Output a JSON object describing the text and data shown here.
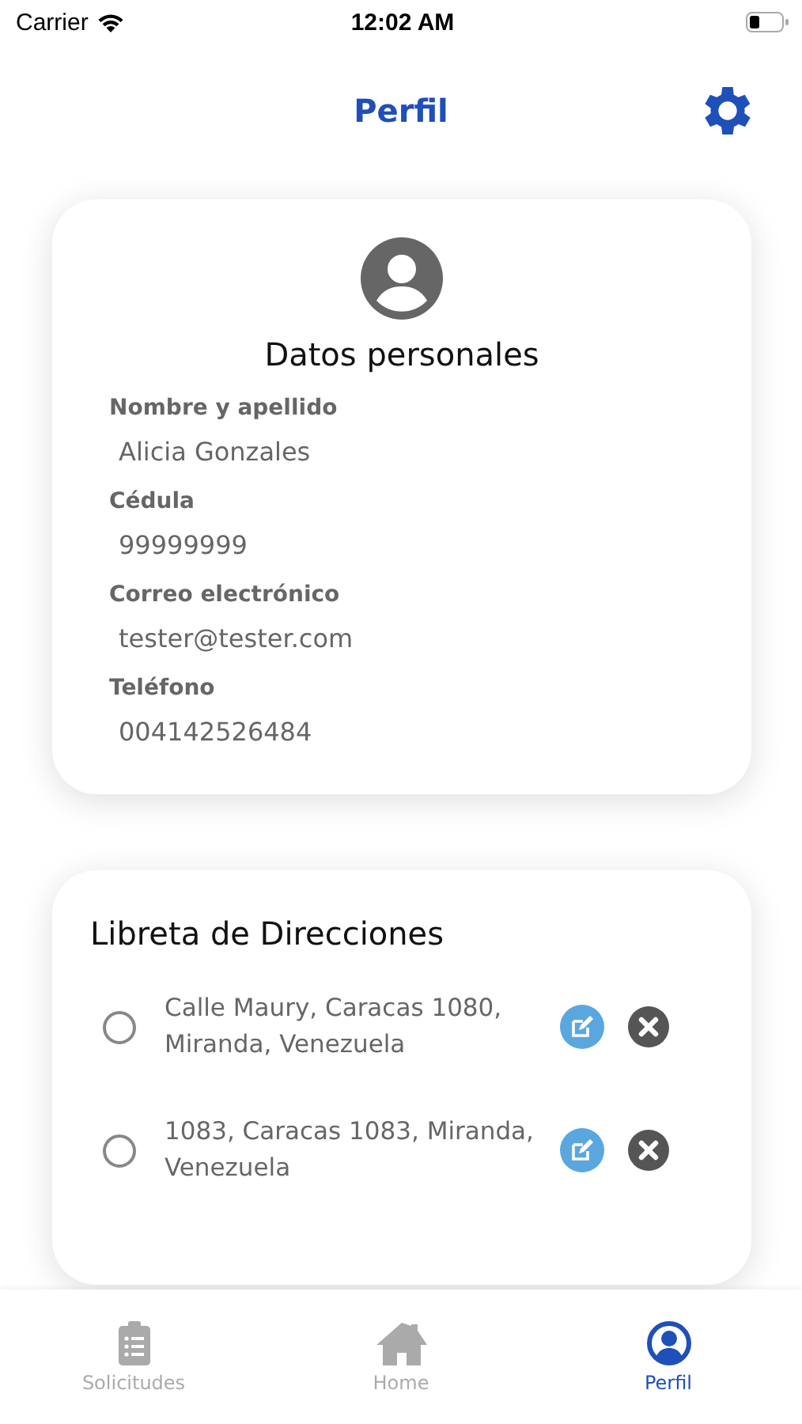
{
  "status_bar": {
    "carrier": "Carrier",
    "time": "12:02 AM"
  },
  "header": {
    "title": "Perfil"
  },
  "personal": {
    "title": "Datos personales",
    "fields": [
      {
        "label": "Nombre y apellido",
        "value": "Alicia Gonzales"
      },
      {
        "label": "Cédula",
        "value": "99999999"
      },
      {
        "label": "Correo electrónico",
        "value": "tester@tester.com"
      },
      {
        "label": "Teléfono",
        "value": "004142526484"
      }
    ]
  },
  "addresses": {
    "title": "Libreta de Direcciones",
    "items": [
      {
        "text": "Calle Maury, Caracas 1080, Miranda, Venezuela",
        "selected": false
      },
      {
        "text": "1083, Caracas 1083, Miranda, Venezuela",
        "selected": false
      }
    ]
  },
  "tabs": [
    {
      "label": "Solicitudes",
      "kind": "clipboard",
      "selected": false
    },
    {
      "label": "Home",
      "kind": "home",
      "selected": false
    },
    {
      "label": "Perfil",
      "kind": "person",
      "selected": true
    }
  ]
}
